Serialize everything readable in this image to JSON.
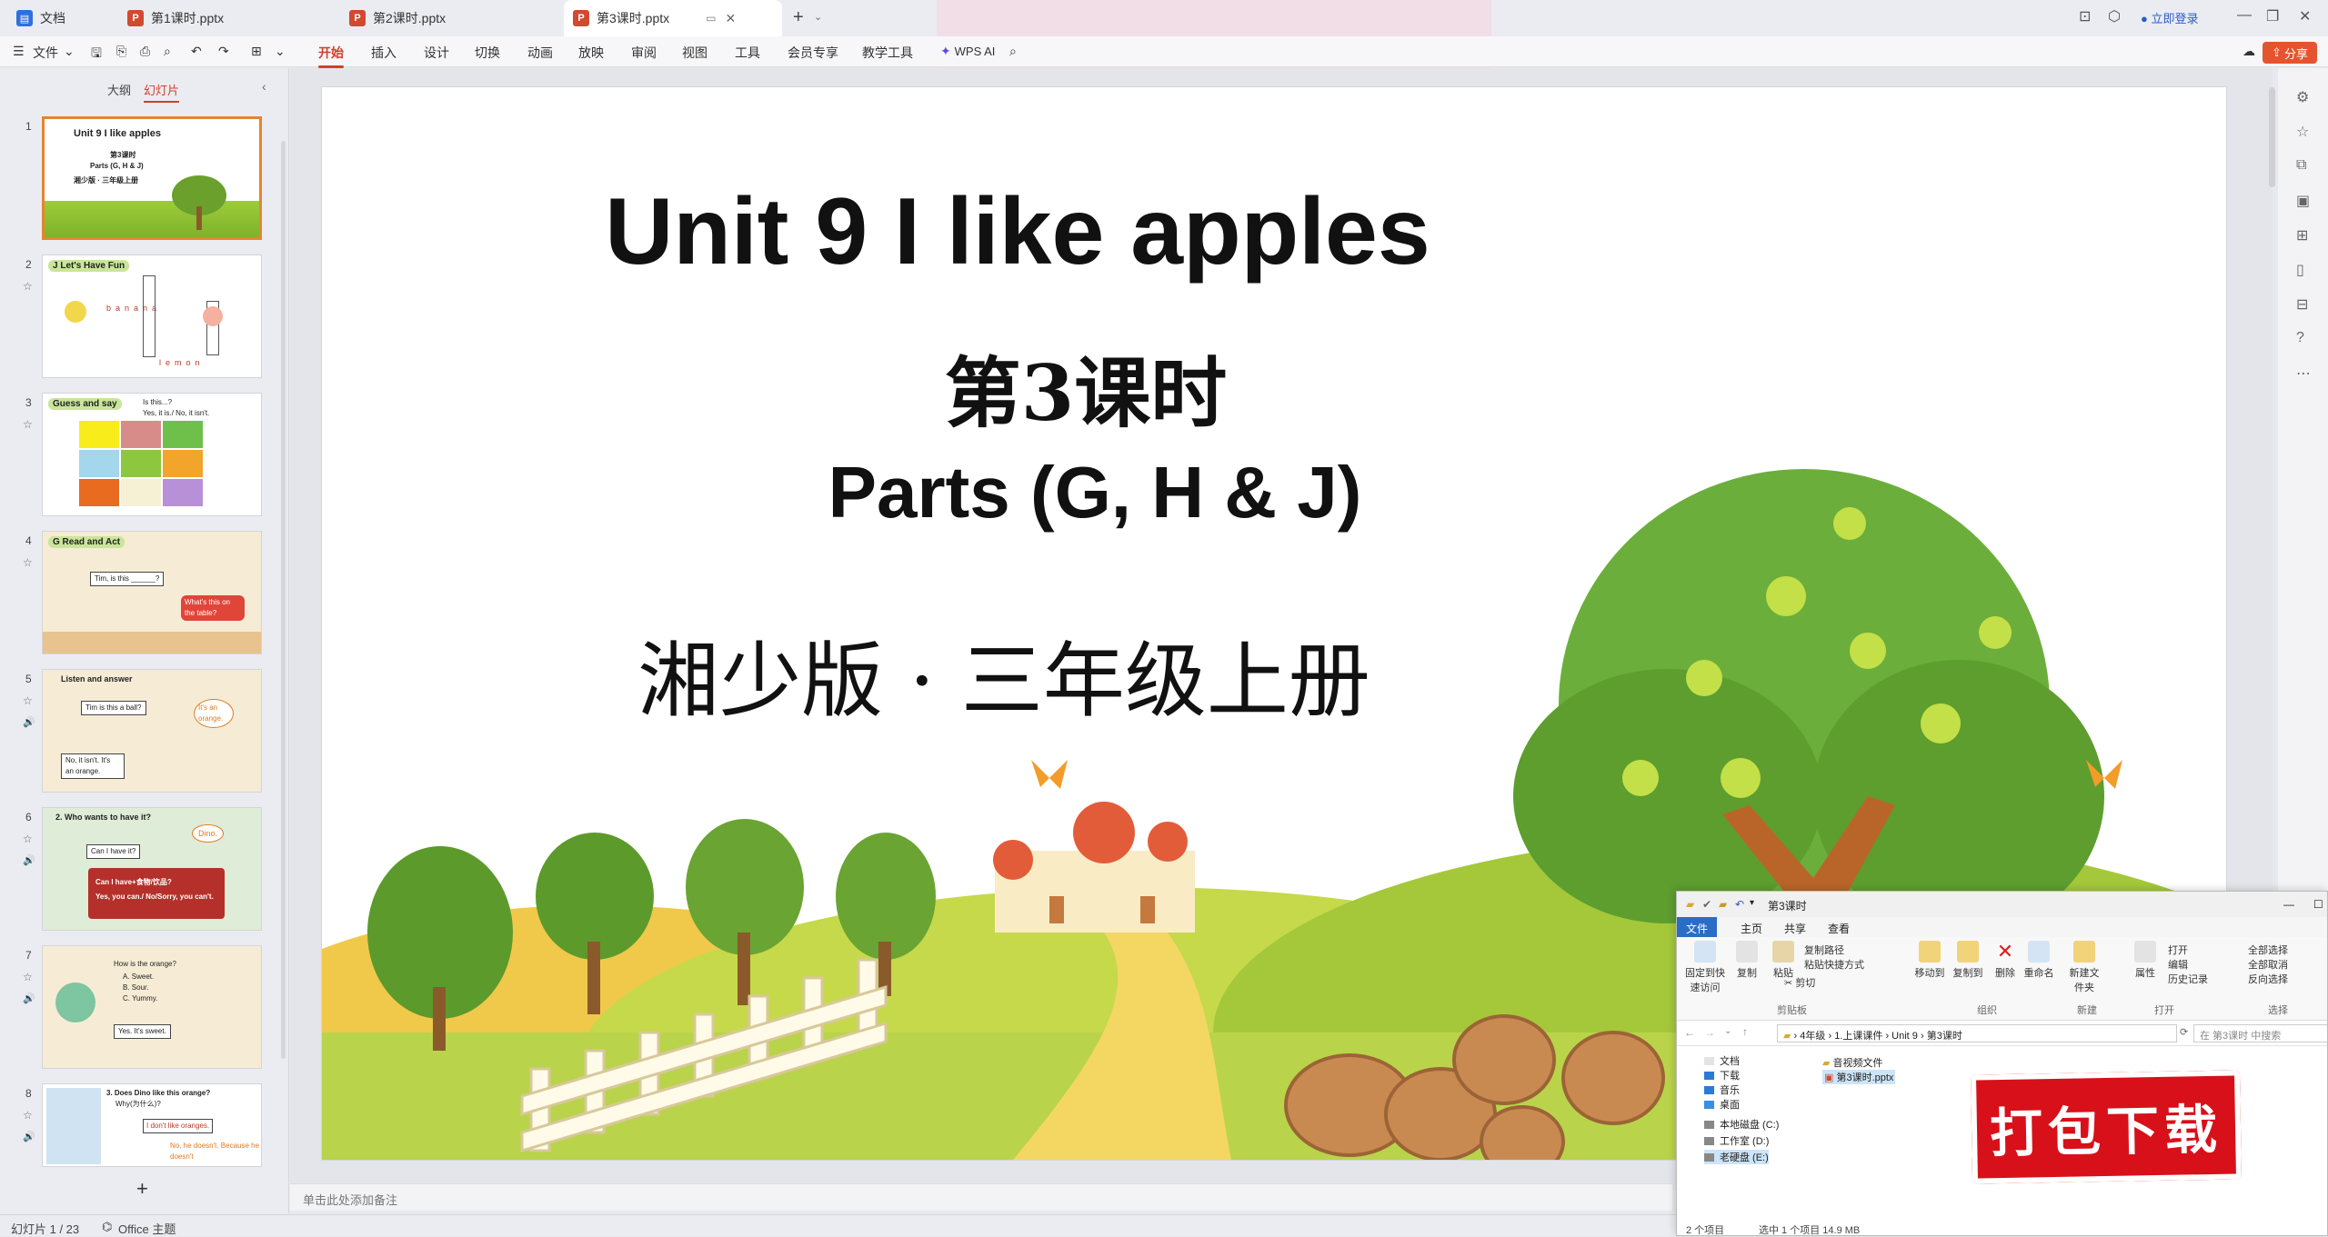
{
  "tabs": [
    {
      "label": "文档",
      "type": "doc"
    },
    {
      "label": "第1课时.pptx",
      "type": "ppt"
    },
    {
      "label": "第2课时.pptx",
      "type": "ppt"
    },
    {
      "label": "第3课时.pptx",
      "type": "ppt",
      "active": true
    }
  ],
  "titlebar": {
    "login": "立即登录"
  },
  "menu": {
    "file": "文件",
    "items": [
      "开始",
      "插入",
      "设计",
      "切换",
      "动画",
      "放映",
      "审阅",
      "视图",
      "工具",
      "会员专享",
      "教学工具"
    ],
    "active": "开始",
    "ai": "WPS AI",
    "share": "分享"
  },
  "leftpanel": {
    "tabs": [
      "大纲",
      "幻灯片"
    ],
    "active_tab": "幻灯片",
    "slides": [
      {
        "num": "1",
        "title": "Unit 9  I like apples",
        "lines": [
          "第3课时",
          "Parts (G, H & J)",
          "湘少版 · 三年级上册"
        ]
      },
      {
        "num": "2",
        "title": "J  Let's Have Fun",
        "lines": [
          "banana",
          "lemon"
        ]
      },
      {
        "num": "3",
        "title": "Guess and say",
        "lines": [
          "Is this...?",
          "Yes, it is./ No, it isn't."
        ]
      },
      {
        "num": "4",
        "title": "G  Read and Act",
        "lines": [
          "Tim, is this ______?",
          "What's this on the table?"
        ]
      },
      {
        "num": "5",
        "title": "Listen and answer",
        "lines": [
          "Tim is this a ball?",
          "It's an orange.",
          "No, it isn't. It's an orange."
        ]
      },
      {
        "num": "6",
        "title": "2. Who wants to have it?",
        "lines": [
          "Dino.",
          "Can I have it?",
          "Can I have+食物/饮品?",
          "Yes, you can./ No/Sorry, you can't."
        ]
      },
      {
        "num": "7",
        "title": "",
        "lines": [
          "How is the orange?",
          "A. Sweet.",
          "B. Sour.",
          "C. Yummy.",
          "Yes. It's sweet."
        ]
      },
      {
        "num": "8",
        "title": "3. Does Dino like this orange?",
        "lines": [
          "Why(为什么)?",
          "I don't like oranges.",
          "No, he doesn't. Because he doesn't"
        ]
      }
    ]
  },
  "slide": {
    "title": "Unit 9  I like apples",
    "lesson": "第3课时",
    "parts": "Parts (G, H & J)",
    "edition": "湘少版 · 三年级上册"
  },
  "notes_placeholder": "单击此处添加备注",
  "statusbar": {
    "slide_info": "幻灯片 1 / 23",
    "theme": "Office 主题"
  },
  "explorer": {
    "title": "第3课时",
    "tabs": [
      "文件",
      "主页",
      "共享",
      "查看"
    ],
    "ribbon": {
      "pin": "固定到快速访问",
      "copy": "复制",
      "paste": "粘贴",
      "copy_path": "复制路径",
      "paste_shortcut": "粘贴快捷方式",
      "cut": "剪切",
      "clipboard_group": "剪贴板",
      "move_to": "移动到",
      "copy_to": "复制到",
      "delete": "删除",
      "rename": "重命名",
      "organize_group": "组织",
      "new_folder": "新建文件夹",
      "new_group": "新建",
      "properties": "属性",
      "open": "打开",
      "edit": "编辑",
      "history": "历史记录",
      "open_group": "打开",
      "select_all": "全部选择",
      "select_none": "全部取消",
      "invert": "反向选择",
      "select_group": "选择"
    },
    "path": [
      "4年级",
      "1.上课课件",
      "Unit 9",
      "第3课时"
    ],
    "search_placeholder": "在 第3课时 中搜索",
    "nav": [
      "文档",
      "下载",
      "音乐",
      "桌面",
      "本地磁盘 (C:)",
      "工作室 (D:)",
      "老硬盘 (E:)"
    ],
    "files": [
      "音视频文件",
      "第3课时.pptx"
    ],
    "status": {
      "count": "2 个项目",
      "selected": "选中 1 个项目  14.9 MB"
    }
  },
  "badge": {
    "label": "打包下载"
  }
}
